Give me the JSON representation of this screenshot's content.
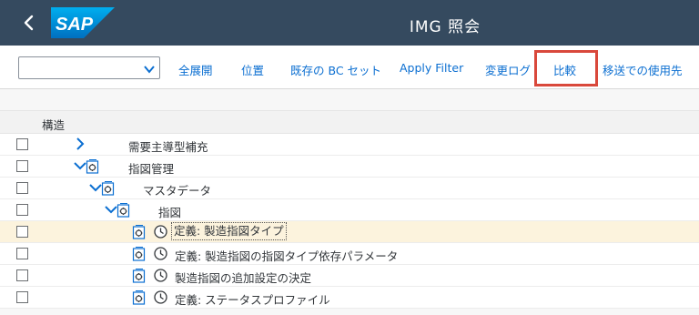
{
  "app": {
    "title": "IMG 照会"
  },
  "toolbar": {
    "select_value": "",
    "buttons": [
      "全展開",
      "位置",
      "既存の BC セット",
      "Apply Filter",
      "変更ログ",
      "比較",
      "移送での使用先"
    ]
  },
  "table": {
    "header": "構造",
    "rows": [
      {
        "label": "需要主導型補充"
      },
      {
        "label": "指図管理"
      },
      {
        "label": "マスタデータ"
      },
      {
        "label": "指図"
      },
      {
        "label": "定義: 製造指図タイプ"
      },
      {
        "label": "定義: 製造指図の指図タイプ依存パラメータ"
      },
      {
        "label": "製造指図の追加設定の決定"
      },
      {
        "label": "定義: ステータスプロファイル"
      }
    ]
  },
  "colors": {
    "header_bg": "#354a5f",
    "link": "#0a6ed1",
    "selected_row": "#fcf3dd",
    "highlight_box": "#d9483b"
  }
}
